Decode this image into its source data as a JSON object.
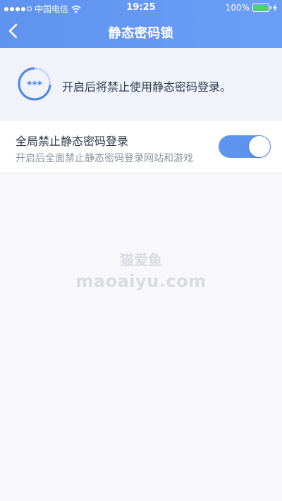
{
  "status_bar": {
    "carrier": "中国电信",
    "time": "19:25",
    "battery_text": "100%",
    "battery_level": 1.0,
    "signal_bars_filled": 4,
    "signal_bars_total": 5
  },
  "nav": {
    "back_icon": "chevron-left-icon",
    "title": "静态密码锁"
  },
  "info": {
    "icon": "password-dots-icon",
    "icon_text": "***",
    "text": "开启后将禁止使用静态密码登录。"
  },
  "setting": {
    "title": "全局禁止静态密码登录",
    "subtitle": "开启后全面禁止静态密码登录网站和游戏",
    "enabled": true
  },
  "watermark": {
    "line1": "猫爱鱼",
    "line2": "maoaiyu.com"
  },
  "colors": {
    "accent": "#5f93f0",
    "banner": "#f1f3fb",
    "text": "#2f3a4a",
    "subtext": "#8a94a2"
  }
}
